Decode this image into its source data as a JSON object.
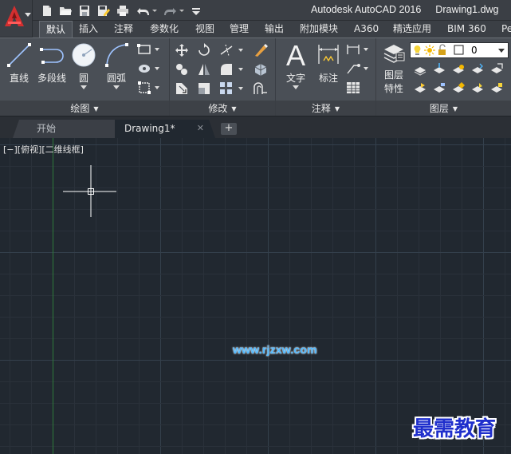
{
  "title": {
    "app": "Autodesk AutoCAD 2016",
    "file": "Drawing1.dwg"
  },
  "quick_access": [
    "new-icon",
    "open-icon",
    "save-icon",
    "save-as-icon",
    "print-icon",
    "undo-icon",
    "redo-icon",
    "customize-icon"
  ],
  "ribbon_tabs": [
    {
      "label": "默认",
      "active": true
    },
    {
      "label": "插入"
    },
    {
      "label": "注释"
    },
    {
      "label": "参数化"
    },
    {
      "label": "视图"
    },
    {
      "label": "管理"
    },
    {
      "label": "输出"
    },
    {
      "label": "附加模块"
    },
    {
      "label": "A360"
    },
    {
      "label": "精选应用"
    },
    {
      "label": "BIM 360"
    },
    {
      "label": "Pe"
    }
  ],
  "panels": {
    "draw": {
      "title": "绘图",
      "tools": {
        "line": "直线",
        "polyline": "多段线",
        "circle": "圆",
        "arc": "圆弧"
      }
    },
    "modify": {
      "title": "修改"
    },
    "annotation": {
      "title": "注释",
      "tools": {
        "text": "文字",
        "dimension": "标注"
      }
    },
    "layers": {
      "title": "图层",
      "layer_properties": "图层\n特性",
      "layer_properties_line1": "图层",
      "layer_properties_line2": "特性",
      "current_layer": "0"
    }
  },
  "doc_tabs": {
    "start": "开始",
    "drawing": "Drawing1*",
    "new": "+"
  },
  "viewport": {
    "label": "[−][俯视][二维线框]"
  },
  "watermarks": {
    "url": "www.rjzxw.com",
    "brand": "最需教育"
  },
  "colors": {
    "canvas": "#212830",
    "grid_minor": "#2a313a",
    "grid_major": "#34404c",
    "axis_y": "#2f7a3a",
    "ribbon": "#4a4f56",
    "titlebar": "#3b3f45",
    "logo_red": "#d32f2f"
  }
}
